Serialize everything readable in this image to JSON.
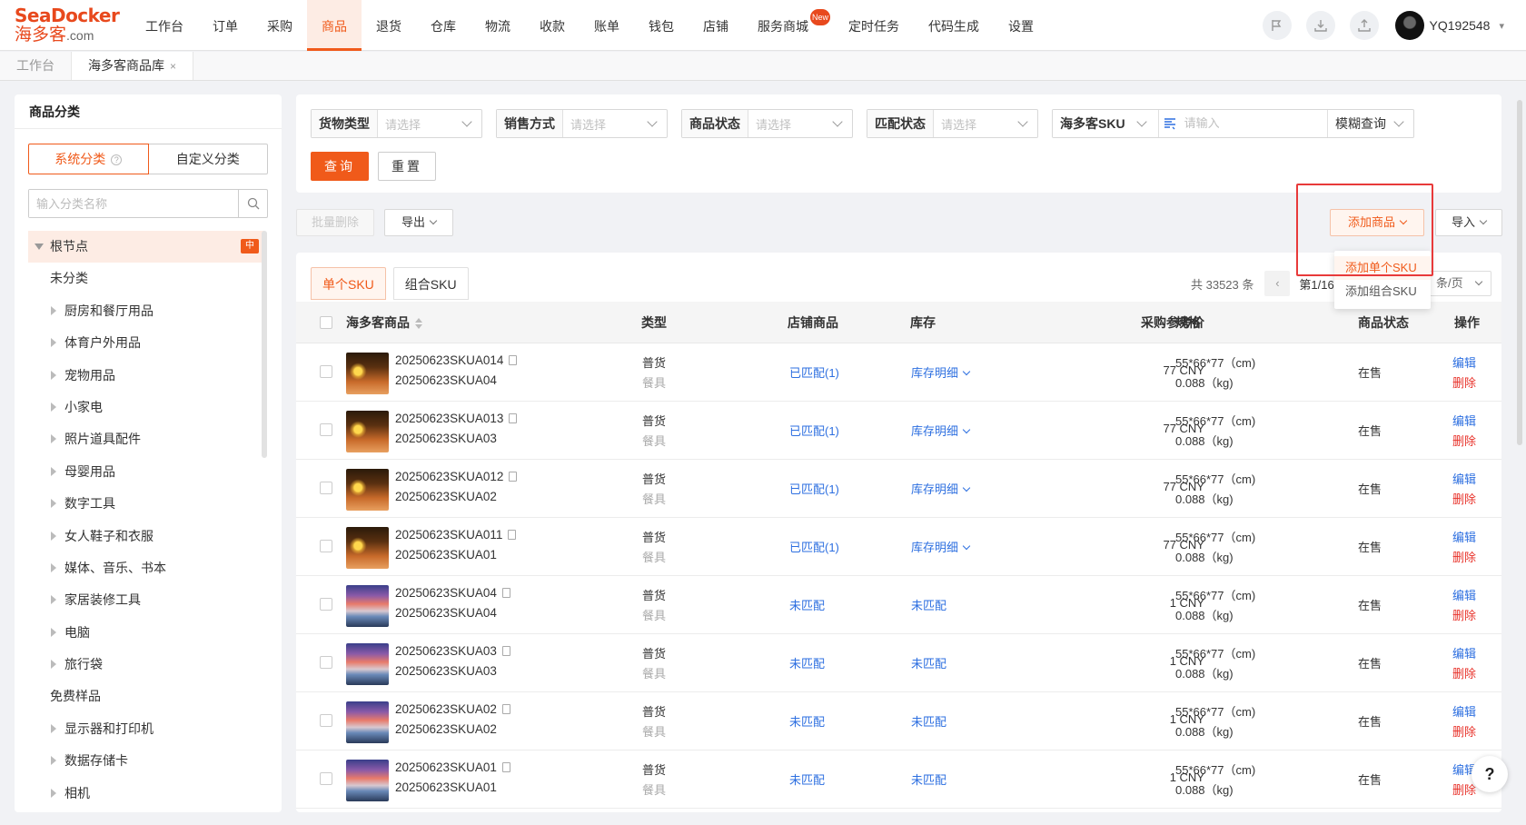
{
  "brand": {
    "line1": "SeaDocker",
    "line2": "海多客",
    "suffix": ".com"
  },
  "nav": {
    "items": [
      "工作台",
      "订单",
      "采购",
      "商品",
      "退货",
      "仓库",
      "物流",
      "收款",
      "账单",
      "钱包",
      "店铺",
      "服务商城",
      "定时任务",
      "代码生成",
      "设置"
    ],
    "active_index": 3,
    "badge": "New",
    "user": "YQ192548"
  },
  "tabs": [
    {
      "label": "工作台",
      "active": false
    },
    {
      "label": "海多客商品库",
      "active": true,
      "close": "×"
    }
  ],
  "sidebar": {
    "title": "商品分类",
    "seg_system": "系统分类",
    "seg_custom": "自定义分类",
    "search_placeholder": "输入分类名称",
    "root": "根节点",
    "root_badge": "中",
    "items": [
      {
        "label": "未分类",
        "level": 1,
        "expandable": false
      },
      {
        "label": "厨房和餐厅用品",
        "level": 2,
        "expandable": true
      },
      {
        "label": "体育户外用品",
        "level": 2,
        "expandable": true
      },
      {
        "label": "宠物用品",
        "level": 2,
        "expandable": true
      },
      {
        "label": "小家电",
        "level": 2,
        "expandable": true
      },
      {
        "label": "照片道具配件",
        "level": 2,
        "expandable": true
      },
      {
        "label": "母婴用品",
        "level": 2,
        "expandable": true
      },
      {
        "label": "数字工具",
        "level": 2,
        "expandable": true
      },
      {
        "label": "女人鞋子和衣服",
        "level": 2,
        "expandable": true
      },
      {
        "label": "媒体、音乐、书本",
        "level": 2,
        "expandable": true
      },
      {
        "label": "家居装修工具",
        "level": 2,
        "expandable": true
      },
      {
        "label": "电脑",
        "level": 2,
        "expandable": true
      },
      {
        "label": "旅行袋",
        "level": 2,
        "expandable": true
      },
      {
        "label": "免费样品",
        "level": 1,
        "expandable": false
      },
      {
        "label": "显示器和打印机",
        "level": 2,
        "expandable": true
      },
      {
        "label": "数据存储卡",
        "level": 2,
        "expandable": true
      },
      {
        "label": "相机",
        "level": 2,
        "expandable": true
      }
    ]
  },
  "filters": {
    "cargo_type": {
      "label": "货物类型",
      "placeholder": "请选择"
    },
    "sale_method": {
      "label": "销售方式",
      "placeholder": "请选择"
    },
    "product_status": {
      "label": "商品状态",
      "placeholder": "请选择"
    },
    "match_status": {
      "label": "匹配状态",
      "placeholder": "请选择"
    },
    "sku_field": {
      "label": "海多客SKU",
      "placeholder": "请输入",
      "mode": "模糊查询"
    },
    "query_btn": "查询",
    "reset_btn": "重置"
  },
  "actions": {
    "batch_delete": "批量删除",
    "export": "导出",
    "add_product": "添加商品",
    "import": "导入",
    "dropdown": [
      "添加单个SKU",
      "添加组合SKU"
    ]
  },
  "table": {
    "subtabs": [
      "单个SKU",
      "组合SKU"
    ],
    "total": "共 33523 条",
    "page": "第1/16",
    "page_size": "条/页",
    "headers": {
      "product": "海多客商品",
      "type": "类型",
      "store": "店铺商品",
      "stock": "库存",
      "price": "采购参考价",
      "spec": "规格",
      "status": "商品状态",
      "ops": "操作"
    },
    "rows": [
      {
        "sku": "20250623SKUA014",
        "sub": "20250623SKUA04",
        "type": "普货",
        "cat": "餐具",
        "store": "已匹配(1)",
        "stock": "库存明细",
        "stock_dropdown": true,
        "price": "77 CNY",
        "spec": "55*66*77（cm)",
        "weight": "0.088（kg)",
        "status": "在售",
        "edit": "编辑",
        "del": "删除",
        "img": "sun"
      },
      {
        "sku": "20250623SKUA013",
        "sub": "20250623SKUA03",
        "type": "普货",
        "cat": "餐具",
        "store": "已匹配(1)",
        "stock": "库存明细",
        "stock_dropdown": true,
        "price": "77 CNY",
        "spec": "55*66*77（cm)",
        "weight": "0.088（kg)",
        "status": "在售",
        "edit": "编辑",
        "del": "删除",
        "img": "sun"
      },
      {
        "sku": "20250623SKUA012",
        "sub": "20250623SKUA02",
        "type": "普货",
        "cat": "餐具",
        "store": "已匹配(1)",
        "stock": "库存明细",
        "stock_dropdown": true,
        "price": "77 CNY",
        "spec": "55*66*77（cm)",
        "weight": "0.088（kg)",
        "status": "在售",
        "edit": "编辑",
        "del": "删除",
        "img": "sun"
      },
      {
        "sku": "20250623SKUA011",
        "sub": "20250623SKUA01",
        "type": "普货",
        "cat": "餐具",
        "store": "已匹配(1)",
        "stock": "库存明细",
        "stock_dropdown": true,
        "price": "77 CNY",
        "spec": "55*66*77（cm)",
        "weight": "0.088（kg)",
        "status": "在售",
        "edit": "编辑",
        "del": "删除",
        "img": "sun"
      },
      {
        "sku": "20250623SKUA04",
        "sub": "20250623SKUA04",
        "type": "普货",
        "cat": "餐具",
        "store": "未匹配",
        "stock": "未匹配",
        "stock_dropdown": false,
        "price": "1 CNY",
        "spec": "55*66*77（cm)",
        "weight": "0.088（kg)",
        "status": "在售",
        "edit": "编辑",
        "del": "删除",
        "img": "sky"
      },
      {
        "sku": "20250623SKUA03",
        "sub": "20250623SKUA03",
        "type": "普货",
        "cat": "餐具",
        "store": "未匹配",
        "stock": "未匹配",
        "stock_dropdown": false,
        "price": "1 CNY",
        "spec": "55*66*77（cm)",
        "weight": "0.088（kg)",
        "status": "在售",
        "edit": "编辑",
        "del": "删除",
        "img": "sky"
      },
      {
        "sku": "20250623SKUA02",
        "sub": "20250623SKUA02",
        "type": "普货",
        "cat": "餐具",
        "store": "未匹配",
        "stock": "未匹配",
        "stock_dropdown": false,
        "price": "1 CNY",
        "spec": "55*66*77（cm)",
        "weight": "0.088（kg)",
        "status": "在售",
        "edit": "编辑",
        "del": "删除",
        "img": "sky"
      },
      {
        "sku": "20250623SKUA01",
        "sub": "20250623SKUA01",
        "type": "普货",
        "cat": "餐具",
        "store": "未匹配",
        "stock": "未匹配",
        "stock_dropdown": false,
        "price": "1 CNY",
        "spec": "55*66*77（cm)",
        "weight": "0.088（kg)",
        "status": "在售",
        "edit": "编辑",
        "del": "删除",
        "img": "sky"
      }
    ]
  },
  "help": "?"
}
